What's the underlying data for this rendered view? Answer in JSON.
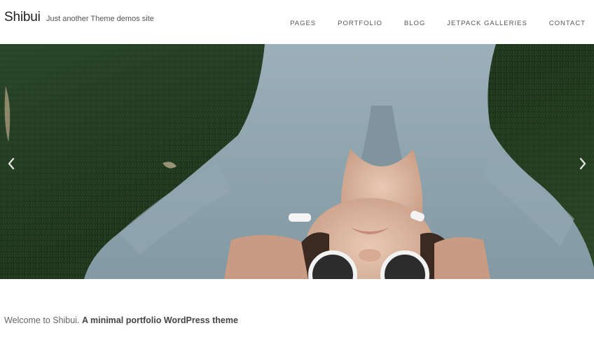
{
  "site": {
    "title": "Shibui",
    "description": "Just another Theme demos site"
  },
  "nav": {
    "items": [
      {
        "label": "PAGES"
      },
      {
        "label": "PORTFOLIO"
      },
      {
        "label": "BLOG"
      },
      {
        "label": "JETPACK GALLERIES"
      },
      {
        "label": "CONTACT"
      }
    ]
  },
  "slider": {
    "prev_icon": "chevron-left-icon",
    "next_icon": "chevron-right-icon"
  },
  "intro": {
    "lead": "Welcome to Shibui.",
    "emphasis": "A minimal portfolio WordPress theme"
  },
  "colors": {
    "background": "#ffffff",
    "grass": "#1f3a1a",
    "shirt": "#8fa4ad",
    "text": "#333333"
  }
}
